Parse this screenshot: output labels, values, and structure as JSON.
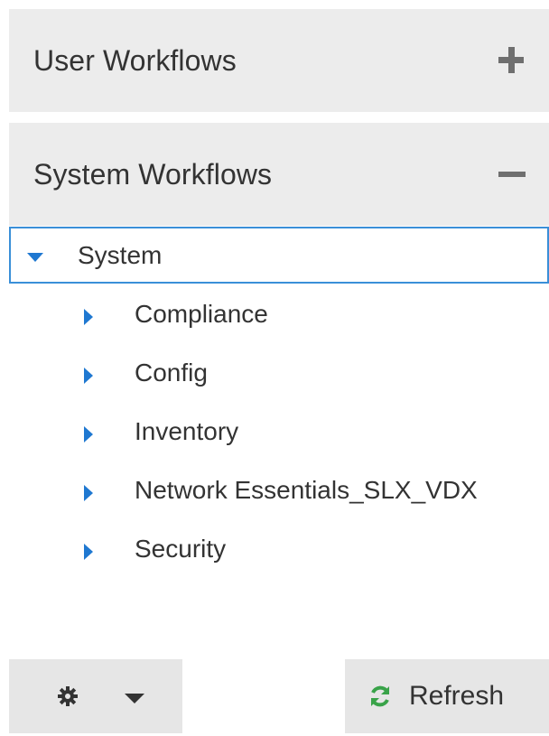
{
  "accordion": {
    "user_workflows": {
      "title": "User Workflows",
      "state_icon": "plus-icon"
    },
    "system_workflows": {
      "title": "System Workflows",
      "state_icon": "minus-icon"
    }
  },
  "tree": {
    "root": {
      "label": "System",
      "expanded": true
    },
    "children": [
      {
        "label": "Compliance"
      },
      {
        "label": "Config"
      },
      {
        "label": "Inventory"
      },
      {
        "label": "Network Essentials_SLX_VDX"
      },
      {
        "label": "Security"
      }
    ]
  },
  "footer": {
    "settings": {
      "icon": "gear-icon",
      "dropdown_icon": "caret-down-icon"
    },
    "refresh": {
      "label": "Refresh",
      "icon": "refresh-icon"
    }
  },
  "colors": {
    "accent_blue": "#1f78d1",
    "selection_border": "#3a8fd8",
    "refresh_green": "#39a349",
    "header_bg": "#ececec",
    "button_bg": "#e6e6e6"
  }
}
